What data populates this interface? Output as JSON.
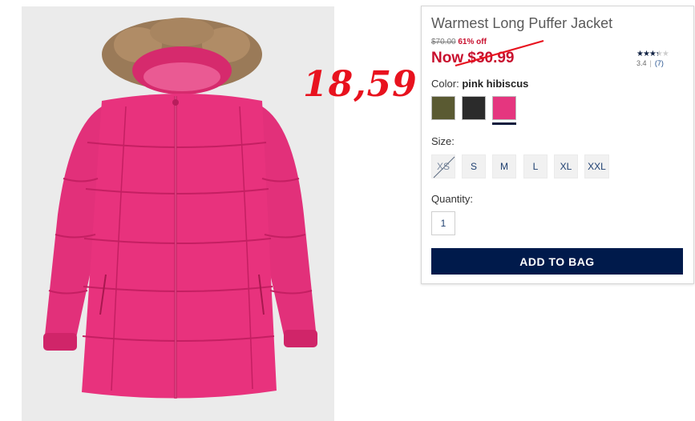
{
  "annotation": {
    "price_note": "18,59"
  },
  "product": {
    "title": "Warmest Long Puffer Jacket",
    "original_price": "$70.00",
    "discount": "61% off",
    "now_price": "Now $30.99",
    "rating": {
      "value": 3.4,
      "value_text": "3.4",
      "count_text": "(7)",
      "separator": "|"
    },
    "color": {
      "label": "Color:",
      "selected": "pink hibiscus"
    },
    "swatches": [
      {
        "name": "olive",
        "color": "#5a5a32"
      },
      {
        "name": "black",
        "color": "#2b2b2b"
      },
      {
        "name": "pink hibiscus",
        "color": "#e5367f"
      }
    ],
    "size": {
      "label": "Size:",
      "options": [
        "XS",
        "S",
        "M",
        "L",
        "XL",
        "XXL"
      ],
      "unavailable": [
        "XS"
      ]
    },
    "quantity": {
      "label": "Quantity:",
      "value": "1"
    },
    "add_to_bag": "ADD TO BAG"
  },
  "colors": {
    "sale_red": "#c8102e",
    "annotation_red": "#e8121e",
    "button_navy": "#001a4b",
    "jacket_pink": "#e8327d",
    "fur": "#9a7a58"
  }
}
